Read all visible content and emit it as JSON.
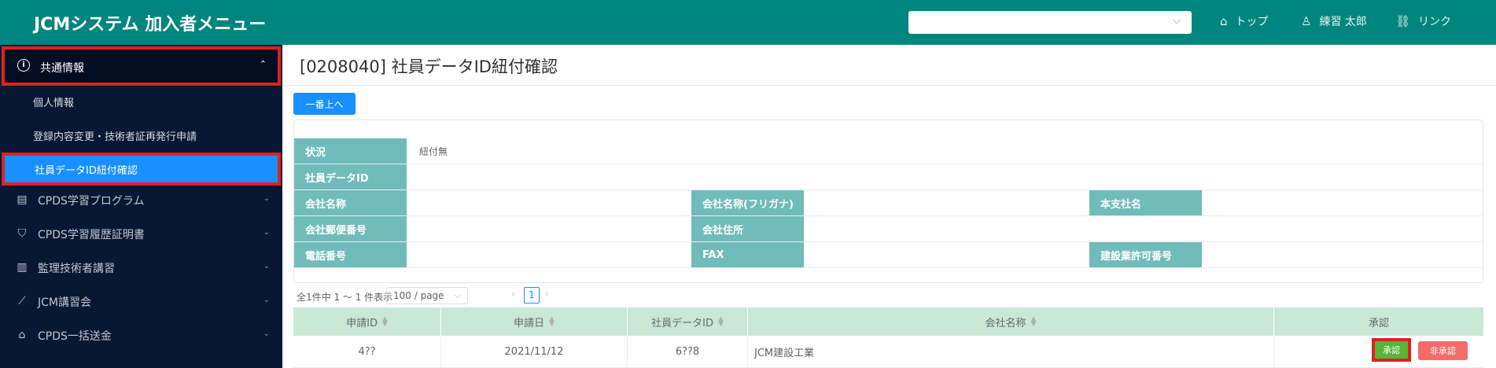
{
  "header": {
    "title": "JCMシステム 加入者メニュー",
    "select_value": "",
    "links": [
      {
        "label": "トップ",
        "icon": "home-icon"
      },
      {
        "label": "練習 太郎",
        "icon": "user-icon"
      },
      {
        "label": "リンク",
        "icon": "link-icon"
      }
    ]
  },
  "sidebar": {
    "section": {
      "label": "共通情報",
      "icon": "info-icon",
      "expanded": true
    },
    "subitems": [
      {
        "label": "個人情報"
      },
      {
        "label": "登録内容変更・技術者証再発行申請"
      },
      {
        "label": "社員データID紐付確認",
        "active": true
      }
    ],
    "items": [
      {
        "label": "CPDS学習プログラム",
        "icon": "document-icon"
      },
      {
        "label": "CPDS学習履歴証明書",
        "icon": "shield-check-icon"
      },
      {
        "label": "監理技術者講習",
        "icon": "bar-chart-icon"
      },
      {
        "label": "JCM講習会",
        "icon": "line-chart-icon"
      },
      {
        "label": "CPDS一括送金",
        "icon": "bank-icon"
      }
    ]
  },
  "main": {
    "page_title": "[0208040] 社員データID紐付確認",
    "top_button": "一番上へ",
    "info": {
      "status_label": "状況",
      "status_value": "紐付無",
      "employee_id_label": "社員データID",
      "employee_id_value": "",
      "company_name_label": "会社名称",
      "company_name_value": "",
      "company_kana_label": "会社名称(フリガナ)",
      "company_kana_value": "",
      "branch_label": "本支社名",
      "branch_value": "",
      "postal_label": "会社郵便番号",
      "postal_value": "",
      "address_label": "会社住所",
      "address_value": "",
      "phone_label": "電話番号",
      "phone_value": "",
      "fax_label": "FAX",
      "fax_value": "",
      "license_label": "建設業許可番号",
      "license_value": ""
    },
    "pagination": {
      "summary": "全1件中 1 ～ 1 件表示",
      "page_size": "100 / page",
      "current_page": "1"
    },
    "table": {
      "columns": [
        "申請ID",
        "申請日",
        "社員データID",
        "会社名称",
        "承認"
      ],
      "rows": [
        {
          "id": "4??",
          "date": "2021/11/12",
          "employee_id": "6??8",
          "company": "JCM建設工業"
        }
      ],
      "approve_label": "承認",
      "reject_label": "非承認"
    }
  },
  "colors": {
    "header_bg": "#00857f",
    "sidebar_bg": "#081733",
    "active_item": "#1890ff",
    "highlight_border": "#e02020",
    "label_bg": "#70bcba",
    "table_header_bg": "#c9e8d5",
    "approve": "#58b43a",
    "reject": "#f36b6b"
  }
}
